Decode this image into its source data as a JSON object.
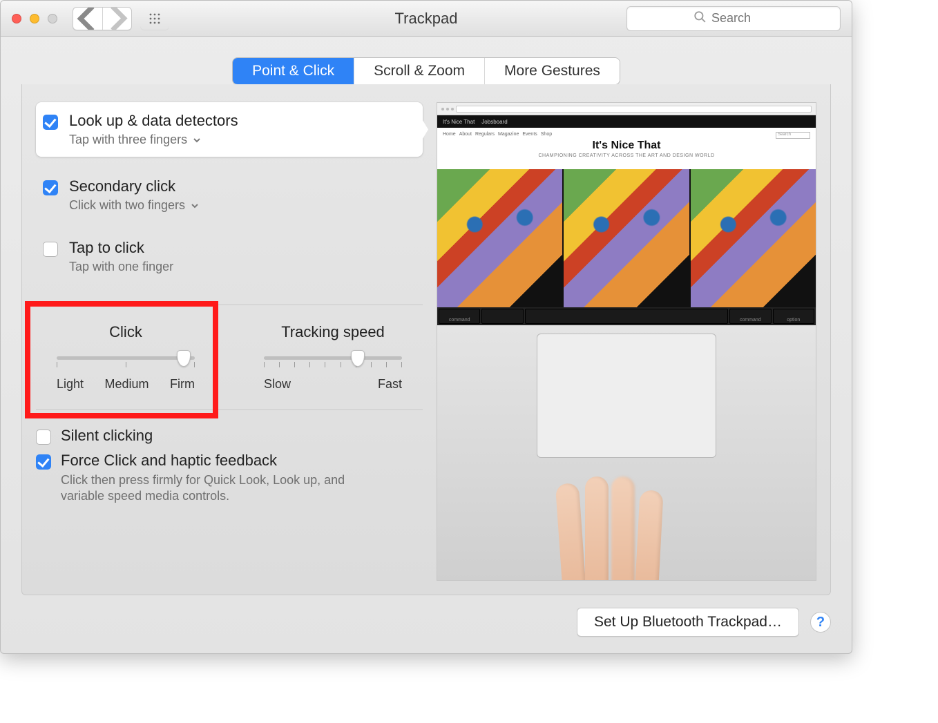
{
  "window": {
    "title": "Trackpad"
  },
  "search": {
    "placeholder": "Search"
  },
  "tabs": [
    {
      "label": "Point & Click",
      "selected": true
    },
    {
      "label": "Scroll & Zoom",
      "selected": false
    },
    {
      "label": "More Gestures",
      "selected": false
    }
  ],
  "options": {
    "lookup": {
      "label": "Look up & data detectors",
      "sub": "Tap with three fingers",
      "checked": true,
      "has_menu": true,
      "highlighted": true
    },
    "secondary": {
      "label": "Secondary click",
      "sub": "Click with two fingers",
      "checked": true,
      "has_menu": true
    },
    "tap": {
      "label": "Tap to click",
      "sub": "Tap with one finger",
      "checked": false,
      "has_menu": false
    }
  },
  "sliders": {
    "click": {
      "title": "Click",
      "labels": [
        "Light",
        "Medium",
        "Firm"
      ],
      "value_pct": 92
    },
    "tracking": {
      "title": "Tracking speed",
      "labels": [
        "Slow",
        "Fast"
      ],
      "ticks": 10,
      "value_pct": 68
    }
  },
  "bottom": {
    "silent": {
      "label": "Silent clicking",
      "checked": false
    },
    "force": {
      "label": "Force Click and haptic feedback",
      "checked": true,
      "desc": "Click then press firmly for Quick Look, Look up, and variable speed media controls."
    }
  },
  "preview": {
    "site_title": "It's Nice That",
    "tab_labels": [
      "It's Nice That",
      "Jobsboard"
    ],
    "nav": [
      "Home",
      "About",
      "Regulars",
      "Magazine",
      "Events",
      "Shop"
    ],
    "tagline": "CHAMPIONING CREATIVITY ACROSS THE ART AND DESIGN WORLD",
    "search_label": "Search",
    "keys": [
      "command",
      "",
      "",
      "",
      "",
      "",
      "command",
      "option"
    ]
  },
  "footer": {
    "bluetooth": "Set Up Bluetooth Trackpad…",
    "help": "?"
  }
}
